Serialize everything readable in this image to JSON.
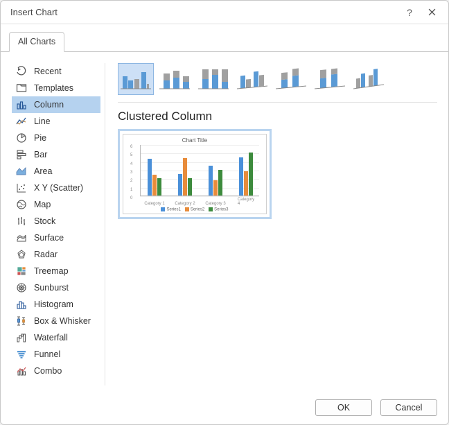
{
  "dialog": {
    "title": "Insert Chart"
  },
  "tabs": {
    "all_charts": "All Charts"
  },
  "sidebar": {
    "items": [
      {
        "label": "Recent"
      },
      {
        "label": "Templates"
      },
      {
        "label": "Column"
      },
      {
        "label": "Line"
      },
      {
        "label": "Pie"
      },
      {
        "label": "Bar"
      },
      {
        "label": "Area"
      },
      {
        "label": "X Y (Scatter)"
      },
      {
        "label": "Map"
      },
      {
        "label": "Stock"
      },
      {
        "label": "Surface"
      },
      {
        "label": "Radar"
      },
      {
        "label": "Treemap"
      },
      {
        "label": "Sunburst"
      },
      {
        "label": "Histogram"
      },
      {
        "label": "Box & Whisker"
      },
      {
        "label": "Waterfall"
      },
      {
        "label": "Funnel"
      },
      {
        "label": "Combo"
      }
    ],
    "selected_index": 2
  },
  "subtypes": {
    "list": [
      "clustered-column",
      "stacked-column",
      "100-stacked-column",
      "3d-clustered-column",
      "3d-stacked-column",
      "3d-100-stacked-column",
      "3d-column"
    ],
    "selected_index": 0,
    "selected_title": "Clustered Column"
  },
  "preview": {
    "title": "Chart Title",
    "legend": [
      "Series1",
      "Series2",
      "Series3"
    ]
  },
  "chart_data": {
    "type": "bar",
    "title": "Chart Title",
    "categories": [
      "Category 1",
      "Category 2",
      "Category 3",
      "Category 4"
    ],
    "series": [
      {
        "name": "Series1",
        "values": [
          4.3,
          2.5,
          3.5,
          4.5
        ]
      },
      {
        "name": "Series2",
        "values": [
          2.4,
          4.4,
          1.8,
          2.8
        ]
      },
      {
        "name": "Series3",
        "values": [
          2.0,
          2.0,
          3.0,
          5.0
        ]
      }
    ],
    "ylim": [
      0,
      6
    ],
    "yticks": [
      0,
      1,
      2,
      3,
      4,
      5,
      6
    ],
    "xlabel": "",
    "ylabel": "",
    "colors": {
      "Series1": "#4a90d9",
      "Series2": "#e88c3b",
      "Series3": "#3d8b3d"
    }
  },
  "footer": {
    "ok": "OK",
    "cancel": "Cancel"
  }
}
